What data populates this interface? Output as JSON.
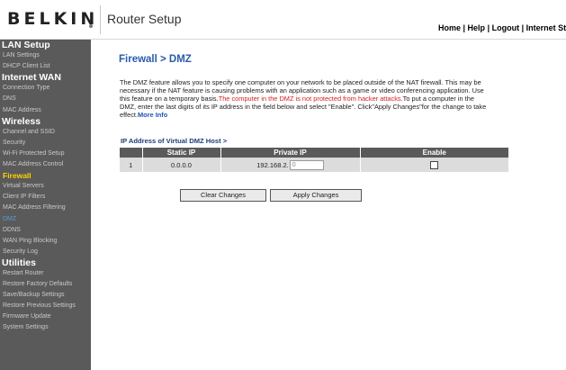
{
  "header": {
    "logo": "BELKIN",
    "title": "Router Setup",
    "links": [
      "Home",
      "Help",
      "Logout",
      "Internet Status"
    ],
    "link_separator": " | "
  },
  "sidebar": {
    "groups": [
      {
        "label": "LAN Setup",
        "items": [
          {
            "label": "LAN Settings"
          },
          {
            "label": "DHCP Client List"
          }
        ]
      },
      {
        "label": "Internet WAN",
        "items": [
          {
            "label": "Connection Type"
          },
          {
            "label": "DNS"
          },
          {
            "label": "MAC Address"
          }
        ]
      },
      {
        "label": "Wireless",
        "items": [
          {
            "label": "Channel and SSID"
          },
          {
            "label": "Security"
          },
          {
            "label": "Wi-Fi Protected Setup"
          },
          {
            "label": "MAC Address Control"
          }
        ]
      },
      {
        "label": "Firewall",
        "active": true,
        "items": [
          {
            "label": "Virtual Servers"
          },
          {
            "label": "Client IP Filters"
          },
          {
            "label": "MAC Address Filtering"
          },
          {
            "label": "DMZ",
            "current": true
          },
          {
            "label": "DDNS"
          },
          {
            "label": "WAN Ping Blocking"
          },
          {
            "label": "Security Log"
          }
        ]
      },
      {
        "label": "Utilities",
        "items": [
          {
            "label": "Restart Router"
          },
          {
            "label": "Restore Factory Defaults"
          },
          {
            "label": "Save/Backup Settings"
          },
          {
            "label": "Restore Previous Settings"
          },
          {
            "label": "Firmware Update"
          },
          {
            "label": "System Settings"
          }
        ]
      }
    ]
  },
  "main": {
    "page_title": "Firewall > DMZ",
    "description": {
      "part1": "The DMZ feature allows you to specify one computer on your network to be placed outside of the NAT firewall. This may be necessary if the NAT feature is causing problems with an application such as a game or video conferencing application. Use this feature on a temporary basis.",
      "warning": "The computer in the DMZ is not protected from hacker attacks.",
      "part2": "To put a computer in the DMZ, enter the last digits of its IP address in the field below and select \"Enable\". Click\"Apply Changes\"for the change to take effect.",
      "more_info": "More Info"
    },
    "table_label": "IP Address of Virtual DMZ Host >",
    "table": {
      "headers": [
        "",
        "Static IP",
        "Private IP",
        "Enable"
      ],
      "row": {
        "index": "1",
        "static_ip": "0.0.0.0",
        "private_ip_prefix": "192.168.2.",
        "private_ip_value": "0",
        "enabled": false
      }
    },
    "buttons": {
      "clear": "Clear Changes",
      "apply": "Apply Changes"
    }
  }
}
